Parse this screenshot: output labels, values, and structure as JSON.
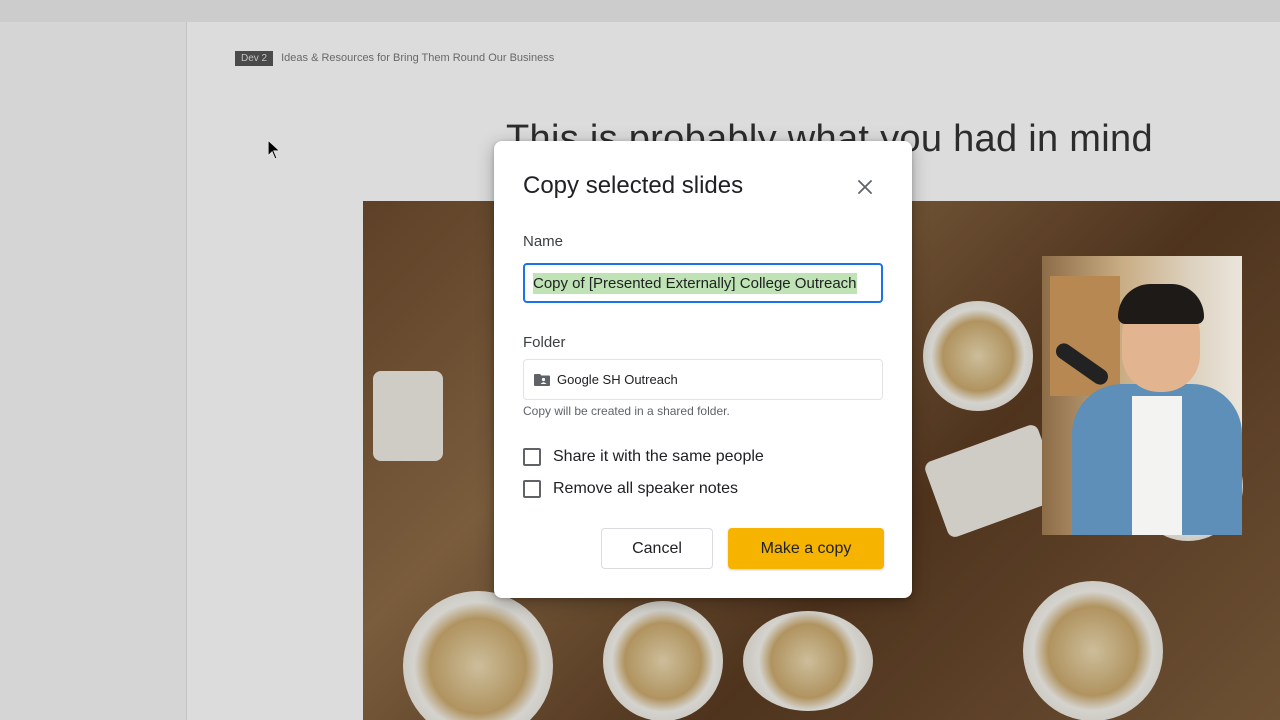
{
  "background": {
    "breadcrumb_tag": "Dev 2",
    "breadcrumb_text": "Ideas & Resources for Bring Them Round Our Business",
    "slide_heading": "This is probably what you had in mind"
  },
  "dialog": {
    "title": "Copy selected slides",
    "name_label": "Name",
    "name_value": "Copy of [Presented Externally] College Outreach",
    "folder_label": "Folder",
    "folder_value": "Google SH Outreach",
    "folder_icon": "shared-folder-icon",
    "folder_hint": "Copy will be created in a shared folder.",
    "checkboxes": [
      {
        "label": "Share it with the same people",
        "checked": false
      },
      {
        "label": "Remove all speaker notes",
        "checked": false
      }
    ],
    "cancel_label": "Cancel",
    "copy_label": "Make a copy"
  },
  "colors": {
    "accent_button": "#f6b400",
    "input_focus": "#1a73e8",
    "selection": "#bfe3b4"
  }
}
